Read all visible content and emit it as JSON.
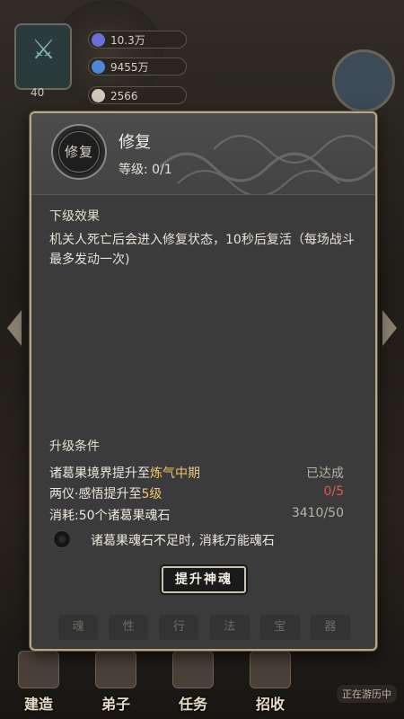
{
  "background": {
    "resources": [
      {
        "value": "10.3万",
        "color": "#9aa0ff"
      },
      {
        "value": "9455万",
        "color": "#8fb8ff"
      },
      {
        "value": "2566",
        "color": "#d8d0c4"
      }
    ],
    "level": "40",
    "bottom_nav": [
      "建造",
      "弟子",
      "任务",
      "招收"
    ],
    "travel_status": "正在游历中"
  },
  "dialog": {
    "skill_icon_text": "修复",
    "skill_name": "修复",
    "level_label": "等级:",
    "level_value": "0/1",
    "next_effect_title": "下级效果",
    "next_effect_desc": "机关人死亡后会进入修复状态，10秒后复活（每场战斗最多发动一次)",
    "upgrade_title": "升级条件",
    "conditions": [
      {
        "prefix": "诸葛果境界提升至",
        "highlight": "炼气中期",
        "status": "已达成",
        "status_color": "grey"
      },
      {
        "prefix": "两仪·感悟提升至",
        "highlight": "5级",
        "status": "0/5",
        "status_color": "red"
      },
      {
        "prefix": "消耗:50个诸葛果魂石",
        "highlight": "",
        "status": "3410/50",
        "status_color": "grey"
      }
    ],
    "toggle_label": "诸葛果魂石不足时, 消耗万能魂石",
    "upgrade_button": "提升神魂",
    "tabs": [
      "魂",
      "性",
      "行",
      "法",
      "宝",
      "器"
    ]
  }
}
